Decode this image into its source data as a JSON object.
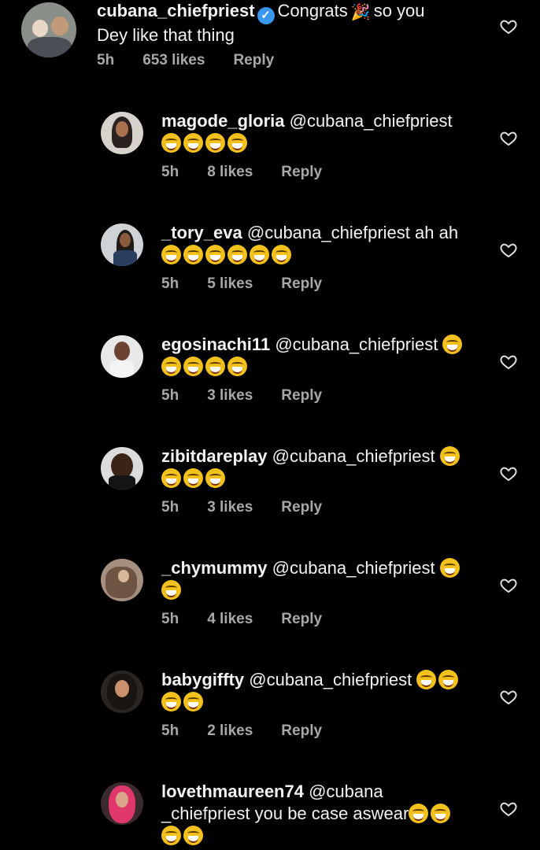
{
  "colors": {
    "background": "#000000",
    "text": "#f2f2f2",
    "meta": "#a8a8a8",
    "verified": "#3897f0"
  },
  "icons": {
    "like": "heart-outline-icon",
    "verified": "verified-badge-icon",
    "laugh": "tears-of-joy-emoji",
    "party": "party-popper-emoji"
  },
  "comments": [
    {
      "username": "cubana_chiefpriest",
      "verified": true,
      "text_line1_a": "Congrats",
      "text_line1_b": "so you",
      "text_line2": "Dey like that thing",
      "time": "5h",
      "likes": "653 likes",
      "reply": "Reply"
    },
    {
      "username": "magode_gloria",
      "mention": "@cubana_chiefpriest",
      "emoji_count": 4,
      "time": "5h",
      "likes": "8 likes",
      "reply": "Reply"
    },
    {
      "username": "_tory_eva",
      "mention": "@cubana_chiefpriest ah ah",
      "emoji_count": 6,
      "time": "5h",
      "likes": "5 likes",
      "reply": "Reply"
    },
    {
      "username": "egosinachi11",
      "mention": "@cubana_chiefpriest",
      "emoji_count": 5,
      "time": "5h",
      "likes": "3 likes",
      "reply": "Reply"
    },
    {
      "username": "zibitdareplay",
      "mention": "@cubana_chiefpriest",
      "emoji_count": 4,
      "time": "5h",
      "likes": "3 likes",
      "reply": "Reply"
    },
    {
      "username": "_chymummy",
      "mention": "@cubana_chiefpriest",
      "emoji_count": 2,
      "time": "5h",
      "likes": "4 likes",
      "reply": "Reply"
    },
    {
      "username": "babygiffty",
      "mention": "@cubana_chiefpriest",
      "emoji_count": 4,
      "time": "5h",
      "likes": "2 likes",
      "reply": "Reply"
    },
    {
      "username": "lovethmaureen74",
      "mention_line1": "@cubana",
      "mention_line2": "_chiefpriest you be case aswear",
      "emoji_count": 4
    }
  ]
}
